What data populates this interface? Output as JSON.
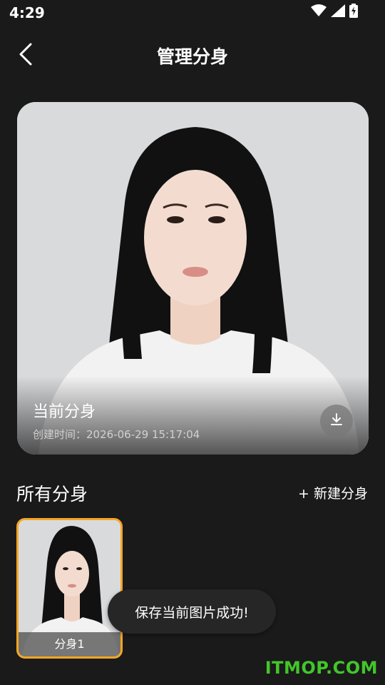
{
  "status_bar": {
    "time": "4:29",
    "icons": [
      "wifi-icon",
      "cell-signal-icon",
      "battery-charging-icon"
    ]
  },
  "app_bar": {
    "back_icon": "chevron-left-icon",
    "title": "管理分身"
  },
  "current_avatar": {
    "label": "当前分身",
    "created_label": "创建时间：",
    "created_time": "2026-06-29 15:17:04",
    "download_icon": "download-icon"
  },
  "all_avatars": {
    "title": "所有分身",
    "new_button": "+ 新建分身",
    "items": [
      {
        "label": "分身1",
        "selected": true
      }
    ]
  },
  "toast": {
    "message": "保存当前图片成功!"
  },
  "watermark": {
    "text": "ITMOP.COM"
  },
  "colors": {
    "background": "#1a1a1a",
    "selected_border": "#f5a623",
    "watermark": "#41c62a"
  }
}
